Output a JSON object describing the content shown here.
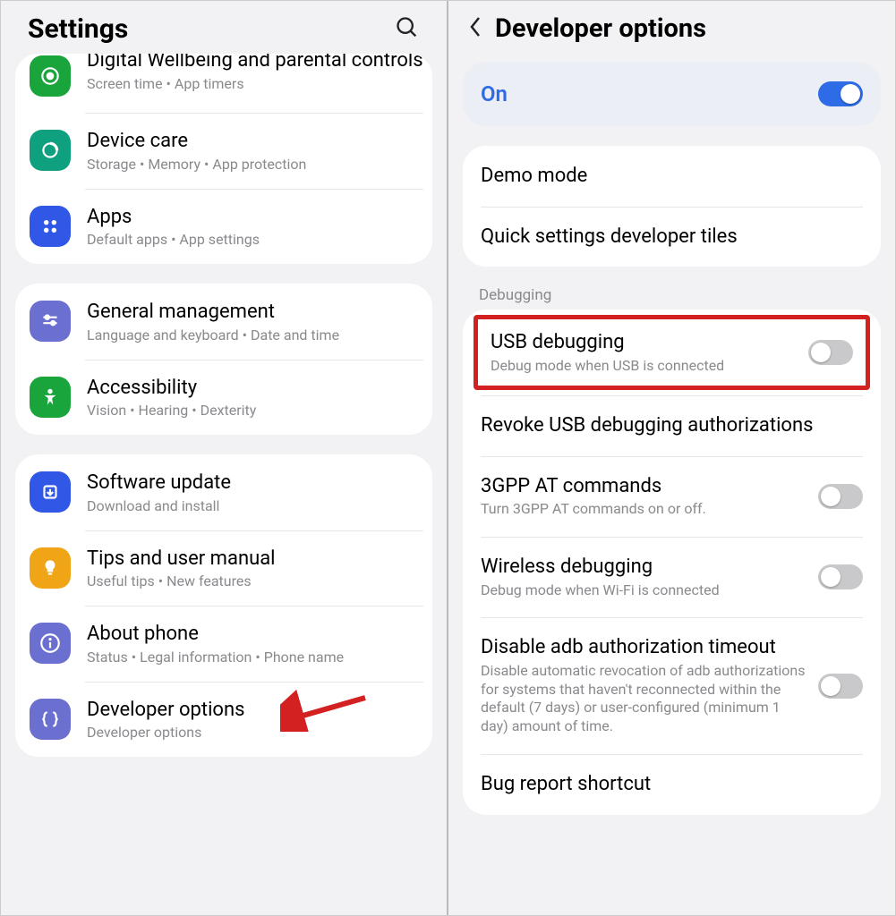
{
  "left": {
    "title": "Settings",
    "icons": {
      "search": "search"
    },
    "groups": [
      {
        "clipped": true,
        "items": [
          {
            "icon": "heart",
            "color": "#1aa53c",
            "title": "Digital Wellbeing and parental controls",
            "subtitle": "Screen time  •  App timers"
          },
          {
            "icon": "device-care",
            "color": "#0fa07f",
            "title": "Device care",
            "subtitle": "Storage  •  Memory  •  App protection"
          },
          {
            "icon": "apps",
            "color": "#3057e6",
            "title": "Apps",
            "subtitle": "Default apps  •  App settings"
          }
        ]
      },
      {
        "items": [
          {
            "icon": "sliders",
            "color": "#6a6fd0",
            "title": "General management",
            "subtitle": "Language and keyboard  •  Date and time"
          },
          {
            "icon": "accessibility",
            "color": "#1aa53c",
            "title": "Accessibility",
            "subtitle": "Vision  •  Hearing  •  Dexterity"
          }
        ]
      },
      {
        "items": [
          {
            "icon": "update",
            "color": "#3057e6",
            "title": "Software update",
            "subtitle": "Download and install"
          },
          {
            "icon": "bulb",
            "color": "#f0a516",
            "title": "Tips and user manual",
            "subtitle": "Useful tips  •  New features"
          },
          {
            "icon": "info",
            "color": "#6a6fd0",
            "title": "About phone",
            "subtitle": "Status  •  Legal information  •  Phone name"
          },
          {
            "icon": "braces",
            "color": "#6a6fd0",
            "title": "Developer options",
            "subtitle": "Developer options",
            "arrow": true
          }
        ]
      }
    ]
  },
  "right": {
    "title": "Developer options",
    "master": {
      "label": "On",
      "state": "on"
    },
    "group1": [
      {
        "title": "Demo mode"
      },
      {
        "title": "Quick settings developer tiles"
      }
    ],
    "debug_section_label": "Debugging",
    "debug_items": [
      {
        "title": "USB debugging",
        "subtitle": "Debug mode when USB is connected",
        "toggle": "off",
        "highlight": true
      },
      {
        "title": "Revoke USB debugging authorizations"
      },
      {
        "title": "3GPP AT commands",
        "subtitle": "Turn 3GPP AT commands on or off.",
        "toggle": "off"
      },
      {
        "title": "Wireless debugging",
        "subtitle": "Debug mode when Wi-Fi is connected",
        "toggle": "off"
      },
      {
        "title": "Disable adb authorization timeout",
        "subtitle": "Disable automatic revocation of adb authorizations for systems that haven't reconnected within the default (7 days) or user-configured (minimum 1 day) amount of time.",
        "toggle": "off"
      },
      {
        "title": "Bug report shortcut"
      }
    ]
  }
}
